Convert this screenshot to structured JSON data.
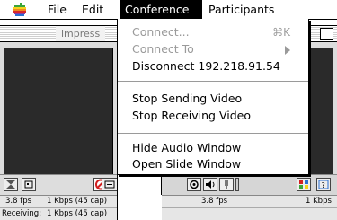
{
  "menubar": {
    "apple_icon": "apple-logo-icon",
    "items": [
      {
        "label": "File"
      },
      {
        "label": "Edit"
      },
      {
        "label": "Conference"
      },
      {
        "label": "Participants"
      }
    ]
  },
  "conference_menu": {
    "items": [
      {
        "label": "Connect...",
        "shortcut": "⌘K",
        "enabled": false
      },
      {
        "label": "Connect To",
        "enabled": false,
        "has_submenu": true
      },
      {
        "label": "Disconnect 192.218.91.54",
        "enabled": true
      },
      {
        "label": "Stop Sending Video",
        "enabled": true
      },
      {
        "label": "Stop Receiving Video",
        "enabled": true
      },
      {
        "label": "Hide Audio Window",
        "enabled": true
      },
      {
        "label": "Open Slide Window",
        "enabled": true
      }
    ]
  },
  "left_window": {
    "title_fragment": "impress",
    "stats": {
      "fps": "3.8 fps",
      "kbps": "1 Kbps (45 cap)",
      "receiving_label": "Receiving:",
      "receiving_kbps": "1 Kbps (45 cap)"
    }
  },
  "right_window": {
    "stats": {
      "fps": "3.8 fps",
      "kbps": "1 Kbps"
    }
  },
  "colors": {
    "menu_highlight": "#000000",
    "disabled_text": "#9a9a9a",
    "video_background": "#2a2a2a",
    "stop_icon_red": "#d22020"
  }
}
